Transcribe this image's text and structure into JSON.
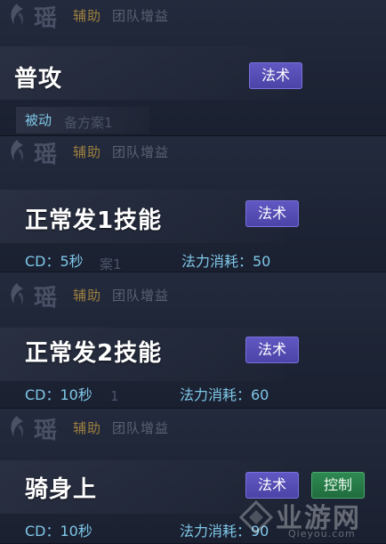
{
  "header": {
    "hero": "瑶",
    "role": "辅助",
    "extra": "团队增益"
  },
  "cards": [
    {
      "name": "普攻",
      "tags": [
        "法术"
      ],
      "info": "被动",
      "ghost": "备方案1"
    },
    {
      "name": "正常发1技能",
      "tags": [
        "法术"
      ],
      "cd": "CD：5秒",
      "mana": "法力消耗：50",
      "ghost": "案1"
    },
    {
      "name": "正常发2技能",
      "tags": [
        "法术"
      ],
      "cd": "CD：10秒",
      "mana": "法力消耗：60",
      "ghost": "1"
    },
    {
      "name": "骑身上",
      "tags": [
        "法术",
        "控制"
      ],
      "cd": "CD：10秒",
      "mana": "法力消耗：90"
    }
  ],
  "watermark": {
    "brand": "业游网",
    "url": "Qieyou.com"
  },
  "colors": {
    "magic_tag": "#5a50bd",
    "control_tag": "#2a7d49",
    "stat_text": "#7fc7e8",
    "role_text": "#9c7f3e"
  }
}
